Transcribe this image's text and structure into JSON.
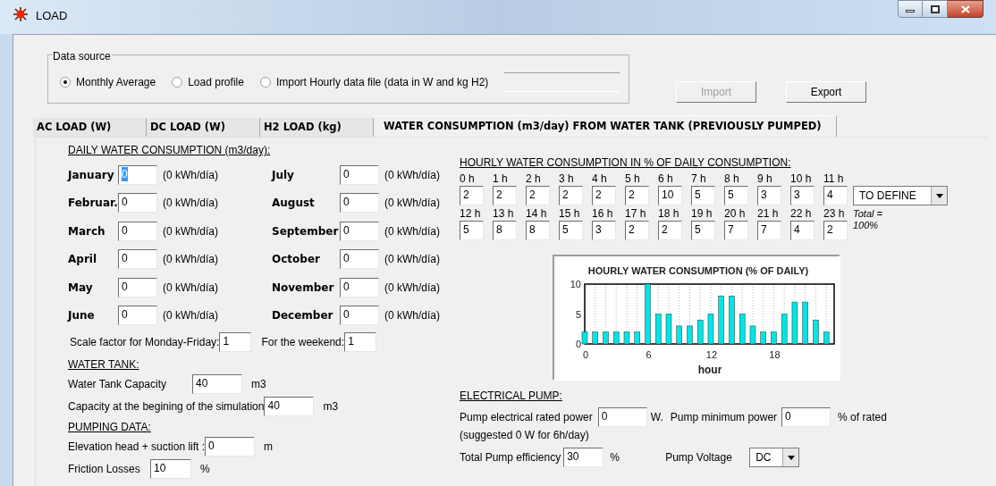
{
  "window": {
    "title": "LOAD"
  },
  "data_source": {
    "legend": "Data source",
    "options": [
      {
        "label": "Monthly Average",
        "selected": true
      },
      {
        "label": "Load profile",
        "selected": false
      },
      {
        "label": "Import Hourly data file (data in W and kg H2)",
        "selected": false
      }
    ],
    "buttons": [
      {
        "label": "Import",
        "disabled": true
      },
      {
        "label": "Export",
        "disabled": false
      }
    ]
  },
  "tabs": [
    {
      "label": "AC LOAD (W)",
      "selected": false
    },
    {
      "label": "DC LOAD (W)",
      "selected": false
    },
    {
      "label": "H2 LOAD (kg)",
      "selected": false
    },
    {
      "label": "WATER CONSUMPTION (m3/day) FROM WATER TANK (PREVIOUSLY PUMPED)",
      "selected": true
    }
  ],
  "daily": {
    "heading": "DAILY WATER CONSUMPTION (m3/day):",
    "months": [
      {
        "label": "January",
        "value": "0",
        "unit": "(0 kWh/día)",
        "focused": true
      },
      {
        "label": "Februar.",
        "value": "0",
        "unit": "(0 kWh/día)",
        "focused": false
      },
      {
        "label": "March",
        "value": "0",
        "unit": "(0 kWh/día)",
        "focused": false
      },
      {
        "label": "April",
        "value": "0",
        "unit": "(0 kWh/día)",
        "focused": false
      },
      {
        "label": "May",
        "value": "0",
        "unit": "(0 kWh/día)",
        "focused": false
      },
      {
        "label": "June",
        "value": "0",
        "unit": "(0 kWh/día)",
        "focused": false
      },
      {
        "label": "July",
        "value": "0",
        "unit": "(0 kWh/día)",
        "focused": false
      },
      {
        "label": "August",
        "value": "0",
        "unit": "(0 kWh/día)",
        "focused": false
      },
      {
        "label": "September",
        "value": "0",
        "unit": "(0 kWh/día)",
        "focused": false
      },
      {
        "label": "October",
        "value": "0",
        "unit": "(0 kWh/día)",
        "focused": false
      },
      {
        "label": "November",
        "value": "0",
        "unit": "(0 kWh/día)",
        "focused": false
      },
      {
        "label": "December",
        "value": "0",
        "unit": "(0 kWh/día)",
        "focused": false
      }
    ],
    "weekday_label": "Scale factor for Monday-Friday:",
    "weekday_value": "1",
    "weekend_label": "For the weekend:",
    "weekend_value": "1"
  },
  "water_tank": {
    "heading": "WATER TANK:",
    "rows": [
      {
        "label": "Water Tank Capacity",
        "value": "40",
        "unit": "m3"
      },
      {
        "label": "Capacity at the begining of the simulation",
        "value": "40",
        "unit": "m3"
      }
    ]
  },
  "pumping": {
    "heading": "PUMPING DATA:",
    "rows": [
      {
        "label": "Elevation head + suction lift :",
        "value": "0",
        "unit": "m"
      },
      {
        "label": "Friction Losses",
        "value": "10",
        "unit": "%"
      }
    ]
  },
  "hourly": {
    "heading": "HOURLY WATER CONSUMPTION IN % OF DAILY CONSUMPTION:",
    "hours": [
      {
        "label": "0 h",
        "value": "2"
      },
      {
        "label": "1 h",
        "value": "2"
      },
      {
        "label": "2 h",
        "value": "2"
      },
      {
        "label": "3 h",
        "value": "2"
      },
      {
        "label": "4 h",
        "value": "2"
      },
      {
        "label": "5 h",
        "value": "2"
      },
      {
        "label": "6 h",
        "value": "10"
      },
      {
        "label": "7 h",
        "value": "5"
      },
      {
        "label": "8 h",
        "value": "5"
      },
      {
        "label": "9 h",
        "value": "3"
      },
      {
        "label": "10 h",
        "value": "3"
      },
      {
        "label": "11 h",
        "value": "4"
      },
      {
        "label": "12 h",
        "value": "5"
      },
      {
        "label": "13 h",
        "value": "8"
      },
      {
        "label": "14 h",
        "value": "8"
      },
      {
        "label": "15 h",
        "value": "5"
      },
      {
        "label": "16 h",
        "value": "3"
      },
      {
        "label": "17 h",
        "value": "2"
      },
      {
        "label": "18 h",
        "value": "2"
      },
      {
        "label": "19 h",
        "value": "5"
      },
      {
        "label": "20 h",
        "value": "7"
      },
      {
        "label": "21 h",
        "value": "7"
      },
      {
        "label": "22 h",
        "value": "4"
      },
      {
        "label": "23 h",
        "value": "2"
      }
    ],
    "profile_select": "TO DEFINE",
    "total_note": "Total = 100%",
    "chart_data": {
      "type": "bar",
      "title": "HOURLY WATER CONSUMPTION (% OF DAILY)",
      "xlabel": "hour",
      "x": [
        0,
        1,
        2,
        3,
        4,
        5,
        6,
        7,
        8,
        9,
        10,
        11,
        12,
        13,
        14,
        15,
        16,
        17,
        18,
        19,
        20,
        21,
        22,
        23
      ],
      "grid": true,
      "values": [
        2,
        2,
        2,
        2,
        2,
        2,
        10,
        5,
        5,
        3,
        3,
        4,
        5,
        8,
        8,
        5,
        3,
        2,
        2,
        5,
        7,
        7,
        4,
        2
      ],
      "xlim": [
        0,
        23.75
      ],
      "ylim": [
        0,
        10
      ],
      "xticks": [
        0,
        6,
        12,
        18
      ],
      "yticks": [
        0,
        5,
        10
      ]
    }
  },
  "electrical_pump": {
    "heading": "ELECTRICAL PUMP:",
    "rated_label": "Pump electrical rated power",
    "rated_value": "0",
    "rated_unit": "W.",
    "min_label": "Pump minimum power",
    "min_value": "0",
    "min_unit": "% of rated",
    "suggestion": "(suggested 0 W for 6h/day)",
    "efficiency_label": "Total Pump efficiency",
    "efficiency_value": "30",
    "efficiency_unit": "%",
    "voltage_label": "Pump Voltage",
    "voltage_value": "DC"
  }
}
